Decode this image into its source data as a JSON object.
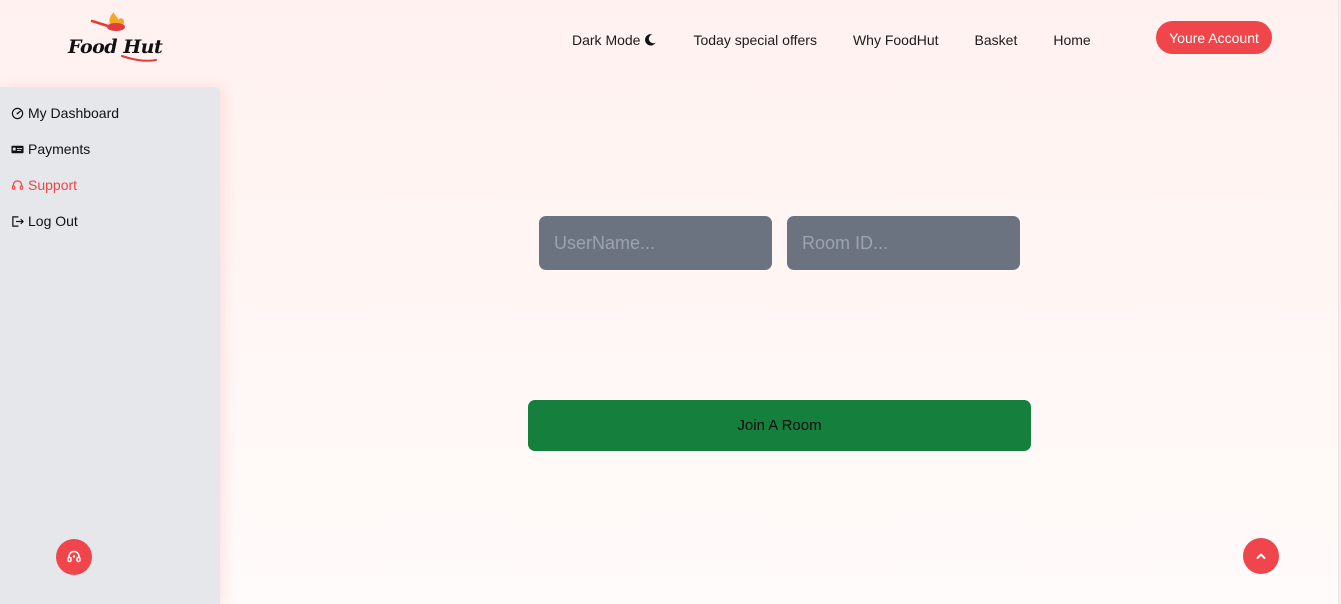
{
  "brand": {
    "logo_text": "Food Hut",
    "icon": "food-hut-logo"
  },
  "nav": {
    "items": [
      {
        "label": "Dark Mode",
        "icon": "moon-icon"
      },
      {
        "label": "Today special offers"
      },
      {
        "label": "Why FoodHut"
      },
      {
        "label": "Basket"
      },
      {
        "label": "Home"
      }
    ],
    "account_label": "Youre Account"
  },
  "sidebar": {
    "items": [
      {
        "label": "My Dashboard",
        "icon": "dashboard-icon"
      },
      {
        "label": "Payments",
        "icon": "payment-card-icon"
      },
      {
        "label": "Support",
        "icon": "headset-icon",
        "active": true
      },
      {
        "label": "Log Out",
        "icon": "logout-icon"
      }
    ],
    "fab_icon": "headset-icon"
  },
  "form": {
    "username_placeholder": "UserName...",
    "username_value": "",
    "room_placeholder": "Room ID...",
    "room_value": "",
    "join_label": "Join A Room"
  },
  "scroll_top": {
    "icon": "chevron-up-icon"
  },
  "colors": {
    "accent": "#f0454b",
    "join_button": "#15803d",
    "input_bg": "#6b7280",
    "sidebar_bg": "#e5e7eb",
    "active_link": "#ef4444"
  }
}
